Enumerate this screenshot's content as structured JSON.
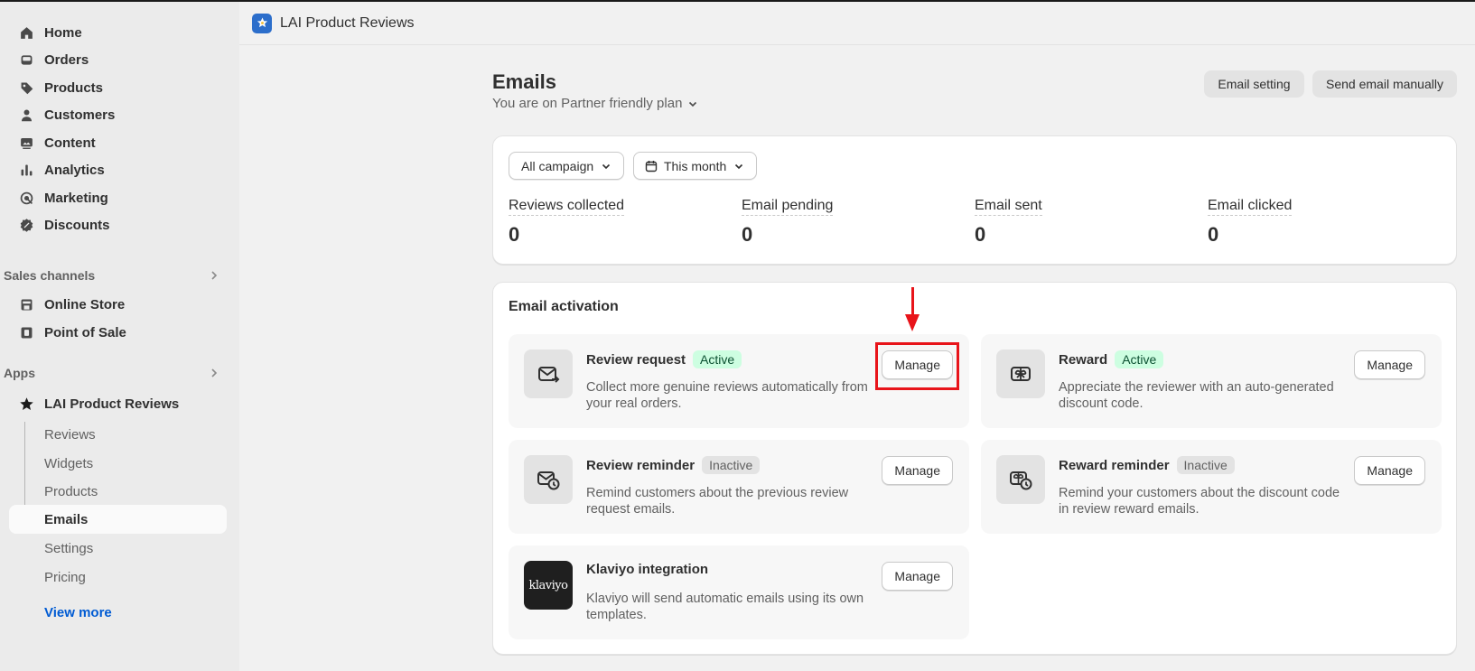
{
  "sidebar": {
    "nav": [
      {
        "label": "Home",
        "icon": "home-icon"
      },
      {
        "label": "Orders",
        "icon": "inbox-icon"
      },
      {
        "label": "Products",
        "icon": "tag-icon"
      },
      {
        "label": "Customers",
        "icon": "person-icon"
      },
      {
        "label": "Content",
        "icon": "image-icon"
      },
      {
        "label": "Analytics",
        "icon": "bar-chart-icon"
      },
      {
        "label": "Marketing",
        "icon": "target-icon"
      },
      {
        "label": "Discounts",
        "icon": "discount-icon"
      }
    ],
    "sales_channels_label": "Sales channels",
    "channels": [
      {
        "label": "Online Store",
        "icon": "store-icon"
      },
      {
        "label": "Point of Sale",
        "icon": "pos-icon"
      }
    ],
    "apps_label": "Apps",
    "app_name": "LAI Product Reviews",
    "app_subitems": [
      "Reviews",
      "Widgets",
      "Products",
      "Emails",
      "Settings",
      "Pricing"
    ],
    "selected_subitem": "Emails",
    "view_more": "View more"
  },
  "appbar": {
    "title": "LAI Product Reviews"
  },
  "page": {
    "title": "Emails",
    "plan": "You are on Partner friendly plan",
    "email_setting": "Email setting",
    "send_manually": "Send email manually"
  },
  "filters": {
    "campaign": "All campaign",
    "period": "This month"
  },
  "stats": [
    {
      "label": "Reviews collected",
      "value": "0"
    },
    {
      "label": "Email pending",
      "value": "0"
    },
    {
      "label": "Email sent",
      "value": "0"
    },
    {
      "label": "Email clicked",
      "value": "0"
    }
  ],
  "activation": {
    "title": "Email activation",
    "tiles": [
      {
        "name": "Review request",
        "status": "Active",
        "desc": "Collect more genuine reviews automatically from your real orders.",
        "manage": "Manage"
      },
      {
        "name": "Reward",
        "status": "Active",
        "desc": "Appreciate the reviewer with an auto-generated discount code.",
        "manage": "Manage"
      },
      {
        "name": "Review reminder",
        "status": "Inactive",
        "desc": "Remind customers about the previous review request emails.",
        "manage": "Manage"
      },
      {
        "name": "Reward reminder",
        "status": "Inactive",
        "desc": "Remind your customers about the discount code in review reward emails.",
        "manage": "Manage"
      },
      {
        "name": "Klaviyo integration",
        "status": "",
        "desc": "Klaviyo will send automatic emails using its own templates.",
        "manage": "Manage",
        "logo_text": "klaviyo"
      }
    ]
  },
  "colors": {
    "accent_link": "#005bd3",
    "annotation_red": "#e8141a",
    "active_badge": "#cdfee1"
  }
}
